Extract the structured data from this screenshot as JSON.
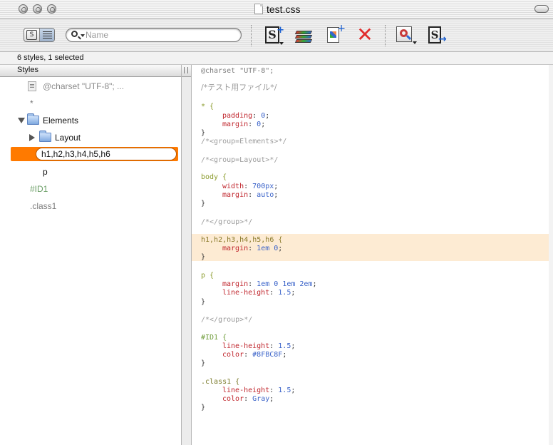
{
  "window": {
    "title": "test.css"
  },
  "toolbar": {
    "search_placeholder": "Name",
    "view_toggle": {
      "left_glyph": "S"
    },
    "buttons": [
      {
        "name": "new-style-button",
        "icon": "new-style-icon",
        "glyph": "S",
        "plus": "+"
      },
      {
        "name": "new-group-button",
        "icon": "stack-icon"
      },
      {
        "name": "new-file-button",
        "icon": "document-add-icon",
        "plus": "+"
      },
      {
        "name": "delete-button",
        "icon": "delete-x-icon",
        "glyph": "✕"
      },
      {
        "name": "validate-button",
        "icon": "validate-icon"
      },
      {
        "name": "export-button",
        "icon": "export-icon",
        "glyph": "S",
        "arrow": "→"
      }
    ]
  },
  "status": {
    "summary": "6 styles, 1 selected"
  },
  "sidebar": {
    "header": "Styles",
    "items": [
      {
        "label": "@charset \"UTF-8\";  ..."
      },
      {
        "label": "*"
      },
      {
        "label": "Elements"
      },
      {
        "label": "Layout"
      },
      {
        "label": "h1,h2,h3,h4,h5,h6"
      },
      {
        "label": "p"
      },
      {
        "label": "#ID1"
      },
      {
        "label": ".class1"
      }
    ]
  },
  "colors": {
    "selection": "#ff7a00",
    "highlight_line": "#fdebd3",
    "property": "#c0262d",
    "value": "#3b63c9",
    "comment": "#9c9c9c",
    "id_color_value": "#8FBC8F"
  },
  "code": {
    "charset": "@charset \"UTF-8\";",
    "comment_jp": "/*テスト用ファイル*/",
    "star_sel": "* {",
    "padding_prop": "padding",
    "padding_val": "0",
    "margin_prop": "margin",
    "margin_val": "0",
    "close": "}",
    "group_elements": "/*<group=Elements>*/",
    "group_layout": "/*<group=Layout>*/",
    "body_sel": "body {",
    "width_prop": "width",
    "width_val": "700px",
    "body_margin_val": "auto",
    "group_end": "/*</group>*/",
    "h_sel": "h1,h2,h3,h4,h5,h6 {",
    "h_margin_val": "1em 0",
    "p_sel": "p {",
    "p_margin_val": "1em 0 1em 2em",
    "lh_prop": "line-height",
    "lh_val": "1.5",
    "id_sel": "#ID1 {",
    "color_prop": "color",
    "id_color_val": "#8FBC8F",
    "class_sel": ".class1 {",
    "class_color_val": "Gray"
  }
}
